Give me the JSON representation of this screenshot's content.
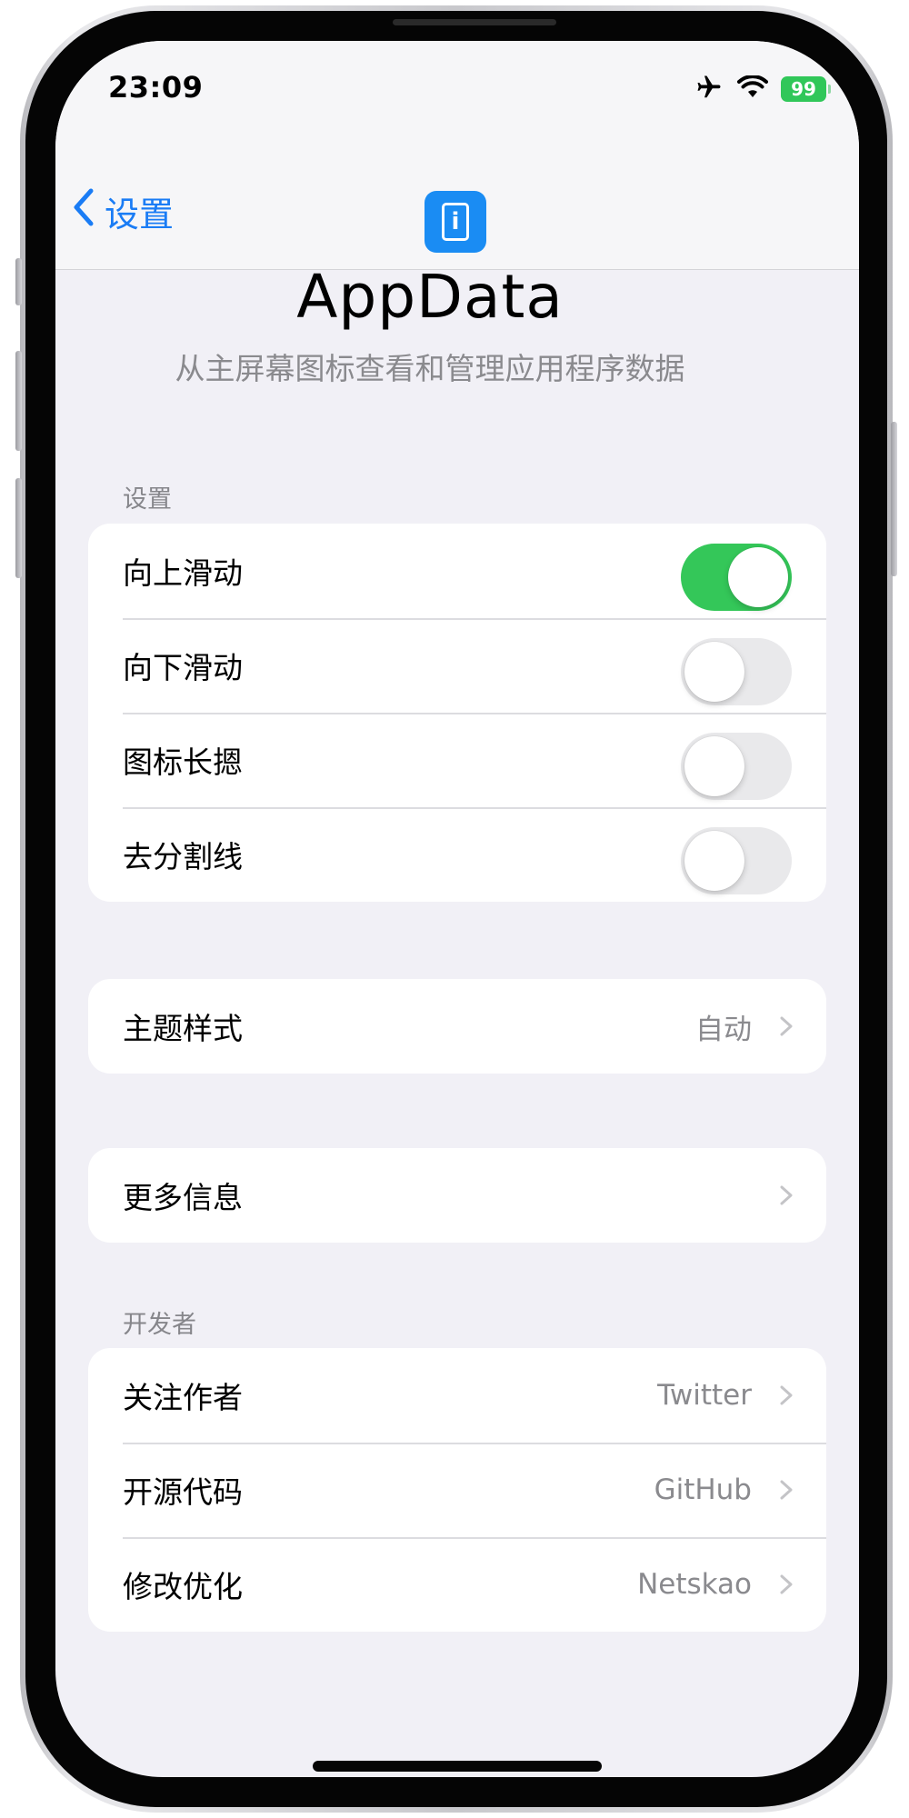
{
  "status_bar": {
    "time": "23:09",
    "battery": "99"
  },
  "nav": {
    "back_label": "设置"
  },
  "header": {
    "title": "AppData",
    "subtitle": "从主屏幕图标查看和管理应用程序数据"
  },
  "settings_section": {
    "header": "设置",
    "rows": [
      {
        "label": "向上滑动",
        "on": true
      },
      {
        "label": "向下滑动",
        "on": false
      },
      {
        "label": "图标长摁",
        "on": false
      },
      {
        "label": "去分割线",
        "on": false
      }
    ]
  },
  "theme": {
    "label": "主题样式",
    "value": "自动"
  },
  "more_info": {
    "label": "更多信息"
  },
  "developer_section": {
    "header": "开发者",
    "rows": [
      {
        "label": "关注作者",
        "value": "Twitter"
      },
      {
        "label": "开源代码",
        "value": "GitHub"
      },
      {
        "label": "修改优化",
        "value": "Netskao"
      }
    ]
  },
  "colors": {
    "accent": "#1a7cf5",
    "toggle_on": "#34c759",
    "toggle_off": "#e9e9eb",
    "background": "#f1f0f6"
  }
}
